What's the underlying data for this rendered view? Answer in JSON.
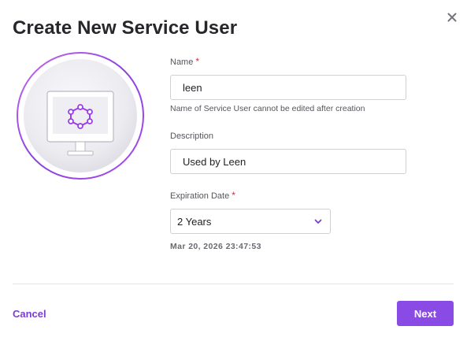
{
  "dialog": {
    "title": "Create New Service User",
    "close_icon": "close-icon",
    "illustration_icon": "monitor-network-icon"
  },
  "form": {
    "name": {
      "label": "Name",
      "required_marker": "*",
      "value": "leen",
      "hint": "Name of Service User cannot be edited after creation"
    },
    "description": {
      "label": "Description",
      "value": "Used by Leen"
    },
    "expiration": {
      "label": "Expiration Date",
      "required_marker": "*",
      "selected": "2 Years",
      "computed_date": "Mar 20, 2026 23:47:53"
    }
  },
  "footer": {
    "cancel_label": "Cancel",
    "next_label": "Next"
  },
  "colors": {
    "accent": "#8a4ae6",
    "link": "#7b3fd0",
    "required": "#e0263a",
    "title": "#27262b"
  }
}
